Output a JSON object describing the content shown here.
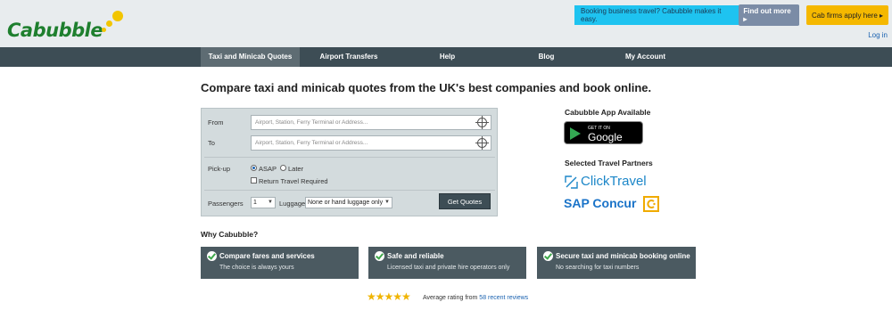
{
  "header": {
    "logo_text": "Cabubble",
    "promo_business_text": "Booking business travel? Cabubble makes it easy.",
    "promo_business_button": "Find out more ▸",
    "promo_cabfirms_button": "Cab firms apply here ▸",
    "login_link": "Log in"
  },
  "nav": {
    "items": [
      {
        "label": "Taxi and Minicab Quotes"
      },
      {
        "label": "Airport Transfers"
      },
      {
        "label": "Help"
      },
      {
        "label": "Blog"
      },
      {
        "label": "My Account"
      }
    ]
  },
  "main": {
    "headline": "Compare taxi and minicab quotes from the UK's best companies and book online."
  },
  "form": {
    "from_label": "From",
    "from_placeholder": "Airport, Station, Ferry Terminal or Address...",
    "to_label": "To",
    "to_placeholder": "Airport, Station, Ferry Terminal or Address...",
    "pickup_label": "Pick-up",
    "pickup_asap": "ASAP",
    "pickup_later": "Later",
    "return_label": "Return Travel Required",
    "passengers_label": "Passengers",
    "passengers_value": "1",
    "luggage_label": "Luggage",
    "luggage_value": "None or hand luggage only",
    "submit_label": "Get Quotes"
  },
  "sidebar": {
    "app_title": "Cabubble App Available",
    "gplay_small": "GET IT ON",
    "gplay_big": "Google Play",
    "partners_title": "Selected Travel Partners",
    "partner_clicktravel": "ClickTravel",
    "partner_sap": "SAP Concur"
  },
  "why": {
    "title": "Why Cabubble?",
    "features": [
      {
        "title": "Compare fares and services",
        "subtitle": "The choice is always yours"
      },
      {
        "title": "Safe and reliable",
        "subtitle": "Licensed taxi and private hire operators only"
      },
      {
        "title": "Secure taxi and minicab booking online",
        "subtitle": "No searching for taxi numbers"
      }
    ]
  },
  "rating": {
    "stars": "★★★★★",
    "stars_value": 4.5,
    "text": "Average rating from",
    "link": "58 recent reviews"
  }
}
